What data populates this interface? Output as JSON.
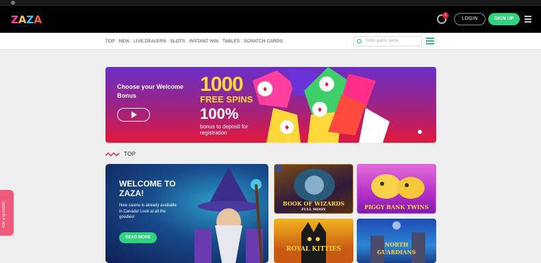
{
  "header": {
    "logo": [
      "Z",
      "A",
      "Z",
      "A"
    ],
    "logo_colors": [
      "#ff3fa0",
      "#ffc83d",
      "#33c6f4",
      "#ff5f3d"
    ],
    "notification_count": "1",
    "login_label": "LOGIN",
    "signup_label": "SIGN UP"
  },
  "nav": {
    "links": [
      "TOP",
      "NEW",
      "LIVE DEALERS",
      "SLOTS",
      "INSTANT WIN",
      "TABLES",
      "SCRATCH CARDS"
    ],
    "search_placeholder": "Enter game name"
  },
  "banner": {
    "heading": "Choose your Welcome Bonus",
    "amount": "1000",
    "spins": "FREE SPINS",
    "percent": "100%",
    "subtext": "bonus to deposit for registration"
  },
  "section": {
    "title": "TOP"
  },
  "featured": {
    "title": "WELCOME TO ZAZA!",
    "description": "New casino is already available in Canada! Look at all the goodies!",
    "button": "READ MORE"
  },
  "games": [
    {
      "title": "BOOK OF WIZARDS",
      "subtitle": "FULL MOON"
    },
    {
      "title": "PIGGY BANK TWINS"
    },
    {
      "title": "ROYAL KITTIES"
    },
    {
      "title": "NORTH GUARDIANS"
    }
  ],
  "side_widget": {
    "label": "Ask a question"
  },
  "colors": {
    "accent": "#2ed37d",
    "brand_pink": "#ef5a7b",
    "banner_top": "#6a2ec8",
    "banner_bottom": "#e3183c"
  }
}
